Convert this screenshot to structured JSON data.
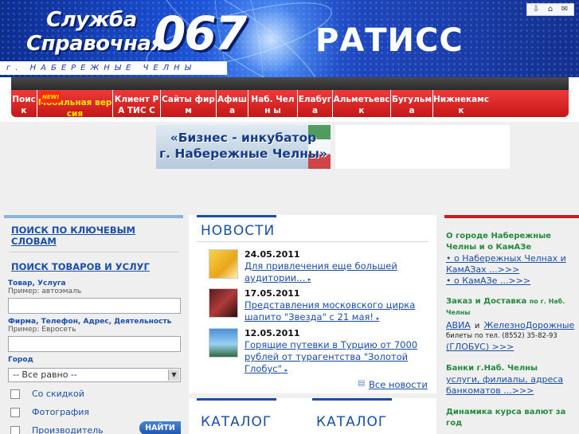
{
  "header": {
    "title_line1": "Служба",
    "title_line2": "Справочная",
    "phone": "067",
    "city": "г. НАБЕРЕЖНЫЕ ЧЕЛНЫ",
    "brand": "РАТИСС",
    "toolbar_icons": [
      "download-icon",
      "home-icon",
      "print-icon"
    ]
  },
  "nav": {
    "new_badge": "NEW!",
    "items": [
      {
        "label": "Поиск"
      },
      {
        "label": "Мобильная версия"
      },
      {
        "label": "Клиент РА ТИС С"
      },
      {
        "label": "Сайты фир м"
      },
      {
        "label": "Афиш а"
      },
      {
        "label": "Наб. Челн ы"
      },
      {
        "label": "Елабуг а"
      },
      {
        "label": "Альметьевс к"
      },
      {
        "label": "Бугульм а"
      },
      {
        "label": "Нижнекамс к"
      }
    ]
  },
  "ad": {
    "line1": "«Бизнес - инкубатор",
    "line2": "г. Набережные Челны»"
  },
  "search": {
    "keyword_link": "ПОИСК ПО КЛЮЧЕВЫМ СЛОВАМ",
    "goods_link": "ПОИСК ТОВАРОВ И УСЛУГ",
    "goods_label": "Товар, Услуга",
    "goods_hint": "Пример: автоэмаль",
    "firm_label": "Фирма, Телефон, Адрес, Деятельность",
    "firm_hint": "Пример: Евросеть",
    "city_label": "Город",
    "city_value": "-- Все равно --",
    "checks": [
      "Со скидкой",
      "Фотография",
      "Производитель"
    ],
    "find_button": "НАЙТИ"
  },
  "news": {
    "heading": "НОВОСТИ",
    "items": [
      {
        "date": "24.05.2011",
        "title": "Для привлечения еще большей аудитории..."
      },
      {
        "date": "17.05.2011",
        "title": "Представления московского цирка шапито \"Звезда\" с 21 мая!"
      },
      {
        "date": "12.05.2011",
        "title": "Горящие путевки в Турцию от 7000 рублей от турагентства \"Золотой Глобус\""
      }
    ],
    "all_news": "Все новости"
  },
  "catalog": {
    "heading1": "КАТАЛОГ",
    "heading2": "КАТАЛОГ"
  },
  "sidebar": {
    "about_heading": "О городе Набережные Челны и о КамАЗе",
    "about_link1": "• о Набережных Челнах и КамАЗах ...>>>",
    "about_link2": "• о КамАЗе ...>>>",
    "order_heading": "Заказ и Доставка",
    "order_heading_small": "по г. Наб. Челны",
    "order_link1": "АВИА",
    "order_and": "и",
    "order_link2": "ЖелезноДорожные",
    "order_text": "билеты по тел. (8552) 35-82-93",
    "order_link3": "(ГЛОБУС) >>>",
    "banks_heading": "Банки г.Наб. Челны",
    "banks_link": "услуги, филиалы, адреса банкоматов ...>>>",
    "rates_heading": "Динамика курса валют за год"
  },
  "colors": {
    "nav_red": "#d42222",
    "link_blue": "#1a4ea8",
    "green_heading": "#248a3c"
  }
}
